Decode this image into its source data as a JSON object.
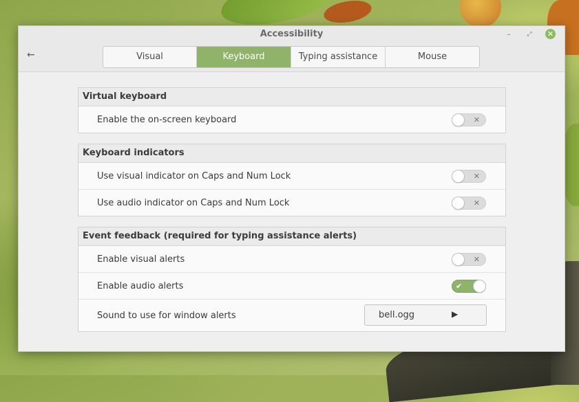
{
  "window": {
    "title": "Accessibility",
    "controls": {
      "minimize": "–",
      "maximize": "⤢",
      "close": "✕"
    },
    "back_icon": "←"
  },
  "tabs": [
    {
      "label": "Visual",
      "active": false
    },
    {
      "label": "Keyboard",
      "active": true
    },
    {
      "label": "Typing assistance",
      "active": false
    },
    {
      "label": "Mouse",
      "active": false
    }
  ],
  "sections": {
    "virtual_keyboard": {
      "title": "Virtual keyboard",
      "rows": [
        {
          "label": "Enable the on-screen keyboard",
          "enabled": false
        }
      ]
    },
    "keyboard_indicators": {
      "title": "Keyboard indicators",
      "rows": [
        {
          "label": "Use visual indicator on Caps and Num Lock",
          "enabled": false
        },
        {
          "label": "Use audio indicator on Caps and Num Lock",
          "enabled": false
        }
      ]
    },
    "event_feedback": {
      "title": "Event feedback (required for typing assistance alerts)",
      "rows": [
        {
          "label": "Enable visual alerts",
          "enabled": false
        },
        {
          "label": "Enable audio alerts",
          "enabled": true
        }
      ],
      "sound": {
        "label": "Sound to use for window alerts",
        "file": "bell.ogg",
        "play_icon": "▶"
      }
    }
  },
  "icons": {
    "off_mark": "✕",
    "on_mark": "✔"
  },
  "colors": {
    "accent": "#8fb469",
    "close_button": "#8bbd5d"
  }
}
